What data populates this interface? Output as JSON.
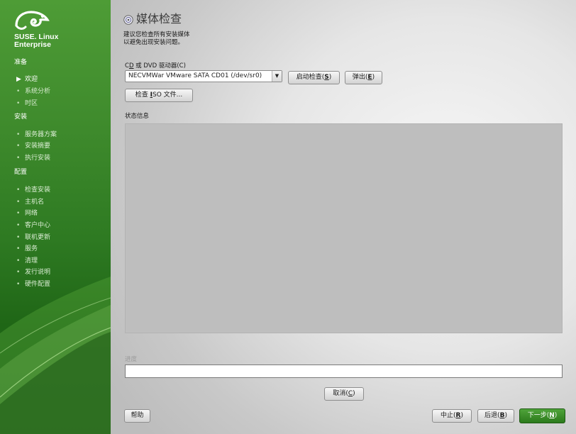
{
  "sidebar": {
    "brand_line1": "SUSE. Linux",
    "brand_line2": "Enterprise",
    "logo_icon": "suse-chameleon-icon",
    "sections": [
      {
        "title": "准备",
        "items": [
          {
            "label": "欢迎",
            "current": true
          },
          {
            "label": "系统分析"
          },
          {
            "label": "时区"
          }
        ]
      },
      {
        "title": "安装",
        "items": [
          {
            "label": "服务器方案"
          },
          {
            "label": "安装摘要"
          },
          {
            "label": "执行安装"
          }
        ]
      },
      {
        "title": "配置",
        "items": [
          {
            "label": "检查安装"
          },
          {
            "label": "主机名"
          },
          {
            "label": "网络"
          },
          {
            "label": "客户中心"
          },
          {
            "label": "联机更新"
          },
          {
            "label": "服务"
          },
          {
            "label": "清理"
          },
          {
            "label": "发行说明"
          },
          {
            "label": "硬件配置"
          }
        ]
      }
    ]
  },
  "main": {
    "title": "媒体检查",
    "title_icon": "media-check-icon",
    "description_line1": "建议您检查所有安装媒体",
    "description_line2": "以避免出现安装问题。",
    "drive_label_pre": "C",
    "drive_label_u": "D",
    "drive_label_post": " 或 DVD 驱动器(C)",
    "drive_value": "NECVMWar VMware SATA CD01 (/dev/sr0)",
    "start_check_pre": "启动检查(",
    "start_check_key": "S",
    "start_check_post": ")",
    "eject_pre": "弹出(",
    "eject_key": "E",
    "eject_post": ")",
    "check_iso_pre": "检查 ",
    "check_iso_key": "I",
    "check_iso_post": "SO 文件...",
    "status_label": "状态信息",
    "progress_label": "进度",
    "progress_value": 0,
    "cancel_pre": "取消(",
    "cancel_key": "C",
    "cancel_post": ")"
  },
  "footer": {
    "help": "帮助",
    "abort_pre": "中止(",
    "abort_key": "R",
    "abort_post": ")",
    "back_pre": "后退(",
    "back_key": "B",
    "back_post": ")",
    "next_pre": "下一步(",
    "next_key": "N",
    "next_post": ")"
  },
  "colors": {
    "sidebar_green": "#2e7a22",
    "primary_button": "#3a8f28",
    "status_panel": "#bebebe"
  }
}
